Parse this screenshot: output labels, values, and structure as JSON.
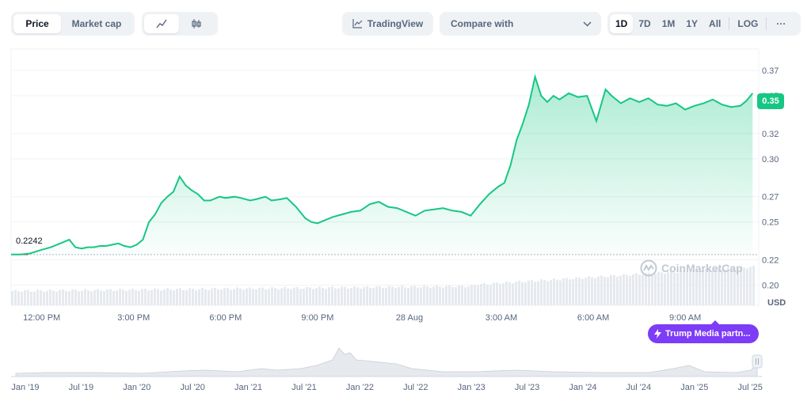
{
  "toolbar": {
    "view_tabs": [
      "Price",
      "Market cap"
    ],
    "tradingview_label": "TradingView",
    "compare_label": "Compare with",
    "ranges": [
      "1D",
      "7D",
      "1M",
      "1Y",
      "All"
    ],
    "log_label": "LOG",
    "more_label": "···",
    "chart_modes": [
      "line-chart-icon",
      "candlestick-icon"
    ]
  },
  "current_price_label": "0.35",
  "open_price_label": "0.2242",
  "currency_label": "USD",
  "watermark": "CoinMarketCap",
  "event_badge": "Trump Media partn...",
  "colors": {
    "line": "#16c784",
    "badge": "#7d3cf7",
    "volume": "#e6e9ee"
  },
  "chart_data": {
    "type": "area",
    "title": "",
    "ylabel": "",
    "xlabel": "",
    "y_axis_ticks": [
      "0.37",
      "0.35",
      "0.32",
      "0.30",
      "0.27",
      "0.25",
      "0.22",
      "0.20"
    ],
    "ylim": [
      0.184,
      0.387
    ],
    "x_tick_labels": [
      "12:00 PM",
      "3:00 PM",
      "6:00 PM",
      "9:00 PM",
      "28 Aug",
      "3:00 AM",
      "6:00 AM",
      "9:00 AM"
    ],
    "x_ticks_hours": [
      1,
      4,
      7,
      10,
      13,
      16,
      19,
      22
    ],
    "xlim_hours": [
      0,
      24.4
    ],
    "baseline": 0.2242,
    "series": [
      {
        "x": [
          0,
          0.3,
          0.6,
          1.0,
          1.3,
          1.6,
          1.9,
          2.1,
          2.3,
          2.5,
          2.7,
          2.9,
          3.1,
          3.3,
          3.5,
          3.7,
          3.9,
          4.1,
          4.3,
          4.5,
          4.7,
          4.9,
          5.1,
          5.3,
          5.5,
          5.7,
          5.9,
          6.1,
          6.3,
          6.5,
          6.8,
          7.0,
          7.3,
          7.5,
          7.8,
          8.0,
          8.3,
          8.5,
          8.8,
          9.0,
          9.3,
          9.6,
          9.8,
          10.0,
          10.2,
          10.5,
          10.8,
          11.1,
          11.4,
          11.7,
          12.0,
          12.3,
          12.6,
          12.9,
          13.2,
          13.5,
          13.8,
          14.1,
          14.4,
          14.7,
          15.0,
          15.3,
          15.6,
          15.9,
          16.1,
          16.3,
          16.5,
          16.7,
          16.9,
          17.1,
          17.3,
          17.5,
          17.7,
          17.9,
          18.2,
          18.5,
          18.8,
          19.1,
          19.4,
          19.6,
          19.9,
          20.2,
          20.5,
          20.8,
          21.1,
          21.4,
          21.7,
          22.0,
          22.3,
          22.6,
          22.9,
          23.2,
          23.5,
          23.8,
          24.0,
          24.2
        ],
        "y": [
          0.2242,
          0.2242,
          0.225,
          0.228,
          0.23,
          0.233,
          0.236,
          0.23,
          0.229,
          0.23,
          0.23,
          0.231,
          0.231,
          0.232,
          0.233,
          0.231,
          0.23,
          0.232,
          0.236,
          0.25,
          0.256,
          0.265,
          0.27,
          0.274,
          0.286,
          0.279,
          0.275,
          0.272,
          0.267,
          0.267,
          0.27,
          0.269,
          0.27,
          0.269,
          0.267,
          0.268,
          0.27,
          0.267,
          0.268,
          0.269,
          0.262,
          0.253,
          0.25,
          0.249,
          0.251,
          0.254,
          0.256,
          0.258,
          0.259,
          0.264,
          0.266,
          0.262,
          0.261,
          0.258,
          0.255,
          0.259,
          0.26,
          0.261,
          0.259,
          0.258,
          0.255,
          0.264,
          0.272,
          0.278,
          0.281,
          0.295,
          0.315,
          0.328,
          0.343,
          0.365,
          0.35,
          0.345,
          0.35,
          0.347,
          0.352,
          0.349,
          0.35,
          0.33,
          0.355,
          0.35,
          0.344,
          0.348,
          0.345,
          0.348,
          0.343,
          0.342,
          0.344,
          0.339,
          0.342,
          0.344,
          0.347,
          0.343,
          0.341,
          0.342,
          0.346,
          0.352
        ]
      }
    ]
  }
}
